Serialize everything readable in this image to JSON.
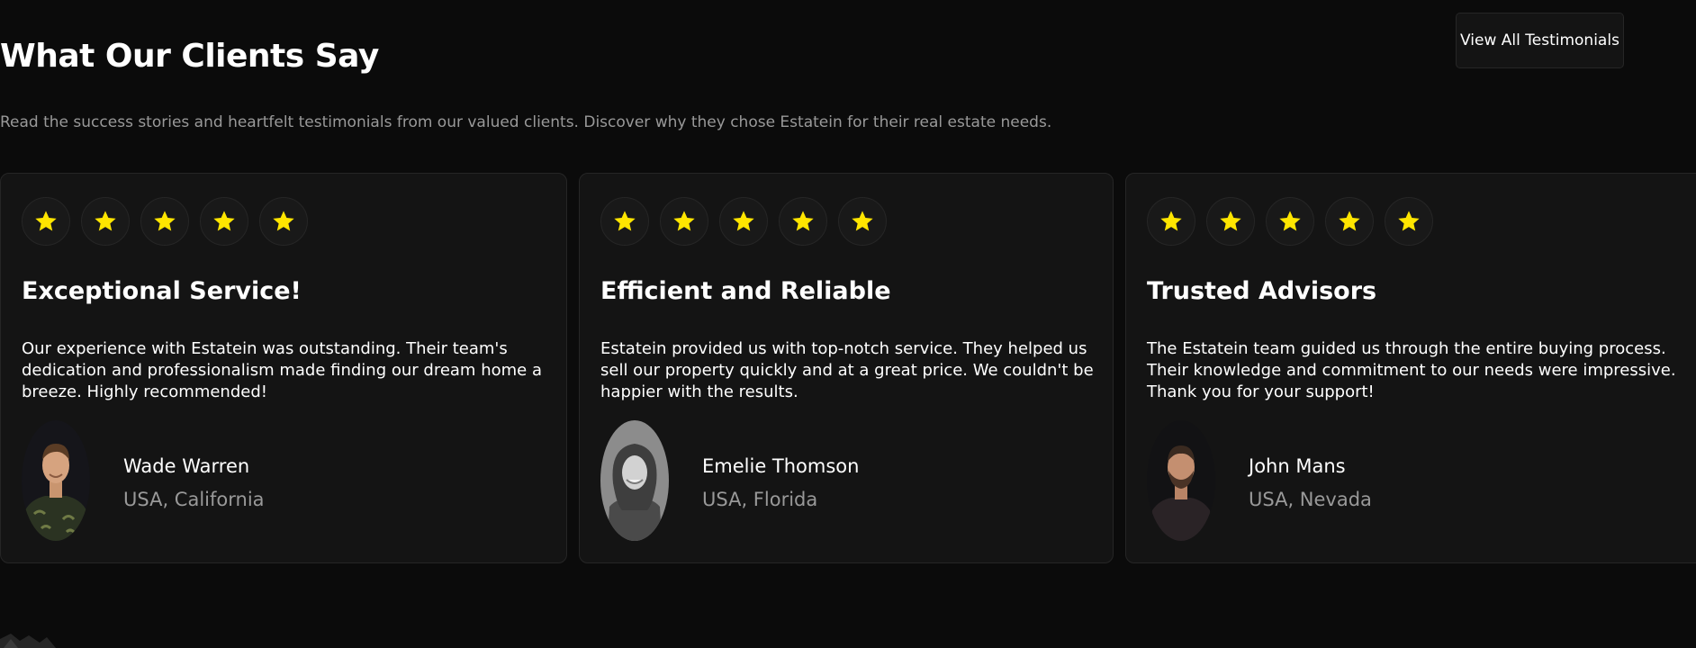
{
  "section": {
    "title": "What Our Clients Say",
    "subtitle": "Read the success stories and heartfelt testimonials from our valued clients. Discover why they chose Estatein for their real estate needs.",
    "view_all_label": "View All Testimonials"
  },
  "colors": {
    "background": "#0b0b0b",
    "card": "#141414",
    "border": "#262626",
    "star": "#ffe500",
    "muted_text": "#999999"
  },
  "icons": {
    "rating": "star-icon"
  },
  "testimonials": [
    {
      "rating": 5,
      "title": "Exceptional Service!",
      "text": "Our experience with Estatein was outstanding. Their team's dedication and professionalism made finding our dream home a breeze. Highly recommended!",
      "name": "Wade Warren",
      "location": "USA, California"
    },
    {
      "rating": 5,
      "title": "Efficient and Reliable",
      "text": "Estatein provided us with top-notch service. They helped us sell our property quickly and at a great price. We couldn't be happier with the results.",
      "name": "Emelie Thomson",
      "location": "USA, Florida"
    },
    {
      "rating": 5,
      "title": "Trusted Advisors",
      "text": "The Estatein team guided us through the entire buying process. Their knowledge and commitment to our needs were impressive. Thank you for your support!",
      "name": "John Mans",
      "location": "USA, Nevada"
    }
  ]
}
